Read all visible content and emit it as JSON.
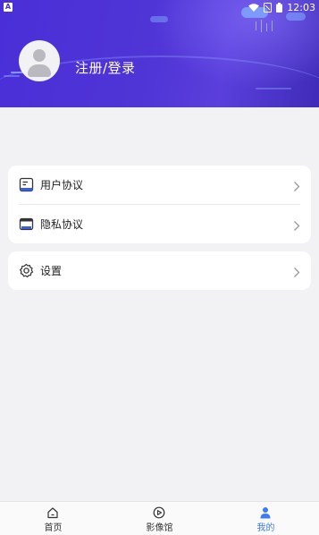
{
  "status_bar": {
    "time": "12:03",
    "left_icon_letter": "A"
  },
  "profile": {
    "login_label": "注册/登录"
  },
  "menu": {
    "group1": [
      {
        "label": "用户协议",
        "icon": "document-icon"
      },
      {
        "label": "隐私协议",
        "icon": "window-icon"
      }
    ],
    "group2": [
      {
        "label": "设置",
        "icon": "gear-icon"
      }
    ]
  },
  "bottom_nav": {
    "tabs": [
      {
        "label": "首页",
        "icon": "home-icon",
        "active": false
      },
      {
        "label": "影像馆",
        "icon": "play-circle-icon",
        "active": false
      },
      {
        "label": "我的",
        "icon": "person-icon",
        "active": true
      }
    ]
  },
  "colors": {
    "header": "#4f34d6",
    "active_tab": "#3d7bf0",
    "background": "#f2f2f4"
  }
}
